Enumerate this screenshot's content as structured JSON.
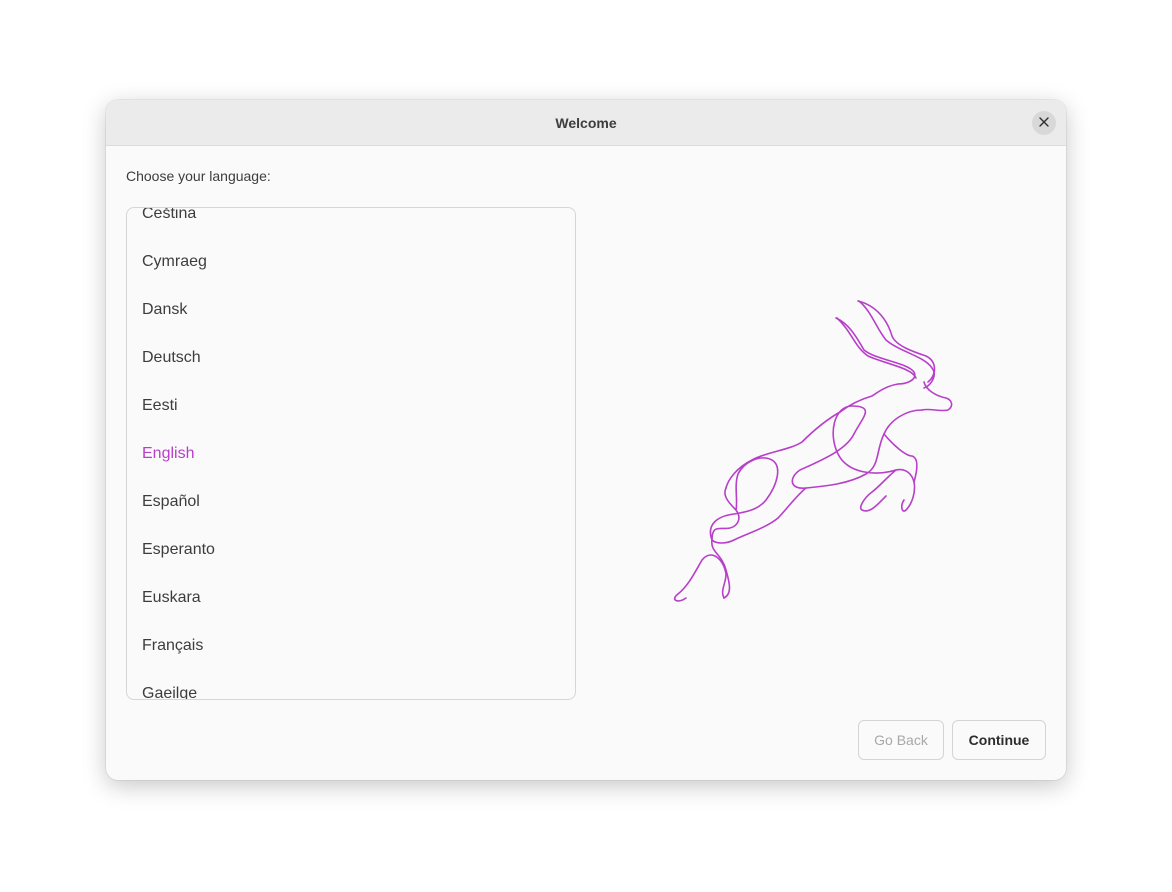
{
  "window": {
    "title": "Welcome"
  },
  "prompt": "Choose your language:",
  "languages": {
    "items": [
      "Čeština",
      "Cymraeg",
      "Dansk",
      "Deutsch",
      "Eesti",
      "English",
      "Español",
      "Esperanto",
      "Euskara",
      "Français",
      "Gaeilge"
    ],
    "selected": "English"
  },
  "buttons": {
    "back_label": "Go Back",
    "continue_label": "Continue"
  },
  "icons": {
    "close": "close-icon",
    "illustration": "antelope-illustration"
  },
  "colors": {
    "accent": "#b73fc9",
    "text": "#3d3d3d",
    "disabled_text": "#a8a8a8"
  }
}
